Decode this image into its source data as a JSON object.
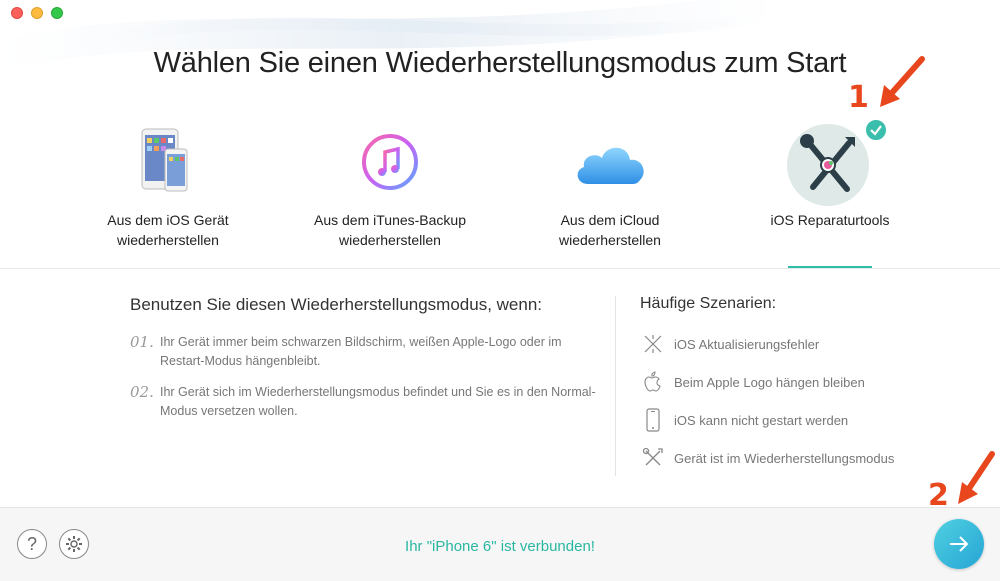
{
  "window": {
    "title": "Wählen Sie einen Wiederherstellungsmodus zum Start"
  },
  "modes": [
    {
      "label_line1": "Aus dem iOS Gerät",
      "label_line2": "wiederherstellen",
      "icon": "iphone-ipad-icon",
      "selected": false
    },
    {
      "label_line1": "Aus dem iTunes-Backup",
      "label_line2": "wiederherstellen",
      "icon": "itunes-icon",
      "selected": false
    },
    {
      "label_line1": "Aus dem iCloud",
      "label_line2": "wiederherstellen",
      "icon": "icloud-icon",
      "selected": false
    },
    {
      "label_line1": "iOS Reparaturtools",
      "label_line2": "",
      "icon": "repair-tools-icon",
      "selected": true
    }
  ],
  "description": {
    "title": "Benutzen Sie diesen Wiederherstellungsmodus, wenn:",
    "items": [
      {
        "num": "01.",
        "text": "Ihr Gerät immer beim schwarzen Bildschirm, weißen Apple-Logo oder im Restart-Modus hängenbleibt."
      },
      {
        "num": "02.",
        "text": "Ihr Gerät sich im Wiederherstellungsmodus befindet und Sie es in den Normal-Modus versetzen wollen."
      }
    ]
  },
  "scenarios": {
    "title": "Häufige Szenarien:",
    "items": [
      {
        "text": "iOS Aktualisierungsfehler",
        "icon": "update-error-icon"
      },
      {
        "text": "Beim Apple Logo hängen bleiben",
        "icon": "apple-logo-icon"
      },
      {
        "text": "iOS kann nicht gestart werden",
        "icon": "phone-icon"
      },
      {
        "text": "Gerät ist im Wiederherstellungsmodus",
        "icon": "tools-icon"
      }
    ]
  },
  "footer": {
    "status": "Ihr \"iPhone 6\" ist verbunden!",
    "help_label": "?"
  },
  "annotations": {
    "one": "1",
    "two": "2"
  },
  "colors": {
    "accent": "#2ab7a1",
    "annotation": "#e8471d"
  }
}
